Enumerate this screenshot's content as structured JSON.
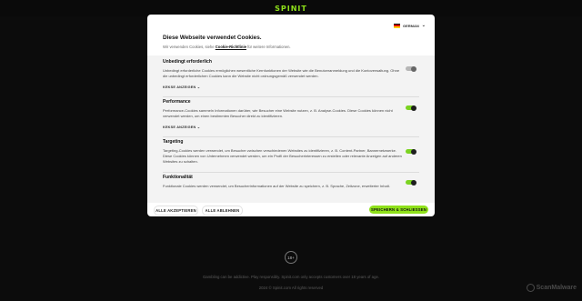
{
  "brand": {
    "logo": "SPINIT",
    "color": "#8fe11a"
  },
  "language": {
    "selected": "GERMAN",
    "flag": "de-flag-icon"
  },
  "header": {
    "title": "Diese Webseite verwendet Cookies.",
    "subtitle_pre": "Wir verwenden Cookies, siehe",
    "subtitle_link": "Cookie-Richtlinie",
    "subtitle_post": "für weitere Informationen."
  },
  "sections": [
    {
      "title": "Unbedingt erforderlich",
      "description": "Unbedingt erforderliche Cookies ermöglichen wesentliche Kernfunktionen der Website wie die Benutzeranmeldung und die Kontoverwaltung. Ohne die unbedingt erforderlichen Cookies kann die Website nicht ordnungsgemäß verwendet werden.",
      "details_label": "KEKSE ANZEIGEN",
      "toggle": "on-disabled"
    },
    {
      "title": "Performance",
      "description": "Performance-Cookies sammeln Informationen darüber, wie Besucher eine Website nutzen, z. B. Analyse-Cookies. Diese Cookies können nicht verwendet werden, um einen bestimmten Besucher direkt zu identifizieren.",
      "details_label": "KEKSE ANZEIGEN",
      "toggle": "on"
    },
    {
      "title": "Targeting",
      "description": "Targeting-Cookies werden verwendet, um Besucher zwischen verschiedenen Websites zu identifizieren, z. B. Content-Partner, Bannernetzwerke. Diese Cookies können von Unternehmen verwendet werden, um ein Profil der Besucherinteressen zu erstellen oder relevante Anzeigen auf anderen Websites zu schalten.",
      "toggle": "on"
    },
    {
      "title": "Funktionalität",
      "description": "Funktionale Cookies werden verwendet, um Besucherinformationen auf der Website zu speichern, z. B. Sprache, Zeitzone, erweiterter Inhalt.",
      "toggle": "on"
    }
  ],
  "buttons": {
    "accept_all": "ALLE AKZEPTIEREN",
    "reject_all": "ALLE ABLEHNEN",
    "save_close": "SPEICHERN & SCHLIESSEN"
  },
  "page_footer": {
    "age_badge": "18+",
    "line1": "Gambling can be addictive. Play responsibly. Spinit.com only accepts customers over 18 years of age.",
    "line2": "2024 © Spinit.com All rights reserved"
  },
  "watermark": "ScanMalware"
}
